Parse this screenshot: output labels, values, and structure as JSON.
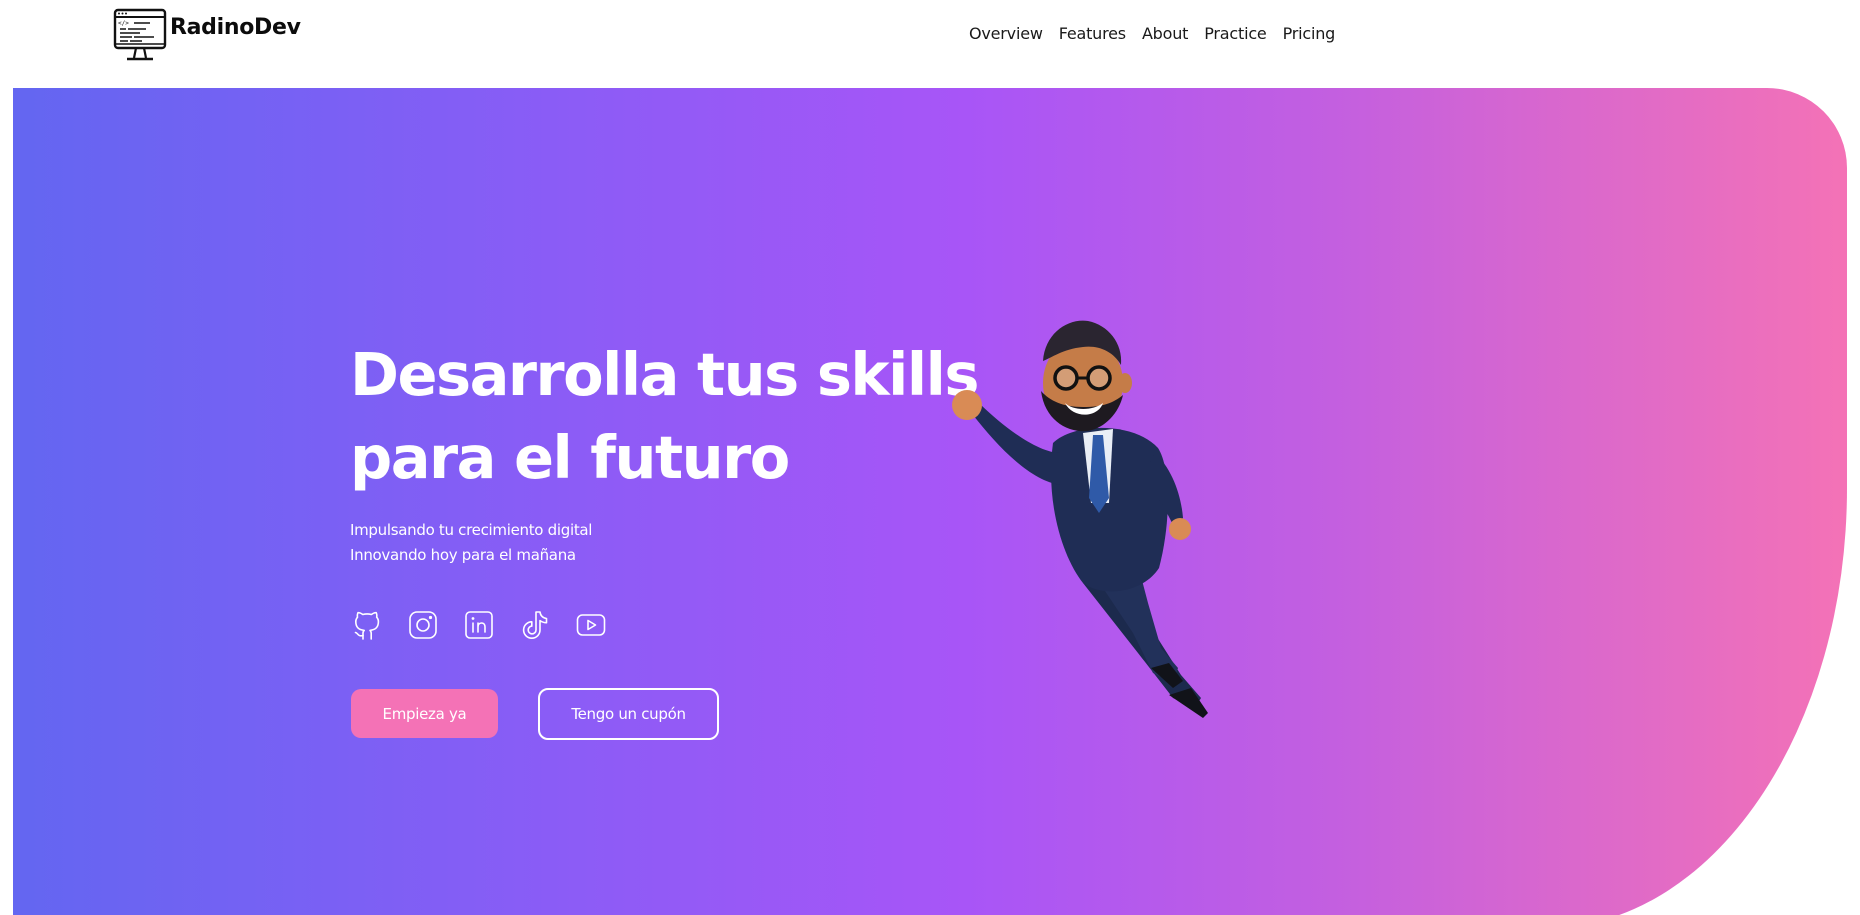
{
  "brand": {
    "name": "RadinoDev",
    "logo_icon": "computer-monitor-code-icon"
  },
  "nav": {
    "items": [
      {
        "label": "Overview"
      },
      {
        "label": "Features"
      },
      {
        "label": "About"
      },
      {
        "label": "Practice"
      },
      {
        "label": "Pricing"
      }
    ]
  },
  "hero": {
    "title_line1": "Desarrolla tus skills",
    "title_line2": "para el futuro",
    "subtitle_line1": "Impulsando tu crecimiento digital",
    "subtitle_line2": "Innovando hoy para el mañana",
    "socials": [
      {
        "icon": "github-icon"
      },
      {
        "icon": "instagram-icon"
      },
      {
        "icon": "linkedin-icon"
      },
      {
        "icon": "tiktok-icon"
      },
      {
        "icon": "youtube-icon"
      }
    ],
    "primary_button": "Empieza ya",
    "secondary_button": "Tengo un cupón",
    "illustration": "flying-businessman-illustration"
  },
  "colors": {
    "gradient_start": "#6366f1",
    "gradient_mid": "#a855f7",
    "gradient_end": "#f472b6",
    "primary_button": "#f472b6",
    "text_on_hero": "#ffffff"
  }
}
